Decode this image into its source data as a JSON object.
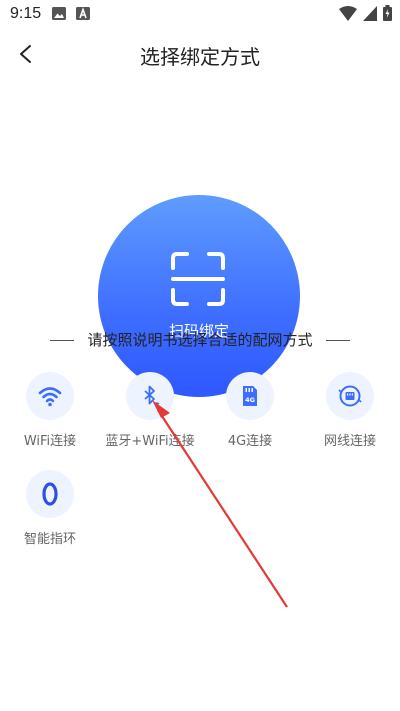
{
  "status_bar": {
    "time": "9:15"
  },
  "header": {
    "title": "选择绑定方式"
  },
  "scan": {
    "label": "扫码绑定"
  },
  "instruction": "请按照说明书选择合适的配网方式",
  "options": [
    {
      "label": "WiFi连接",
      "icon": "wifi-icon"
    },
    {
      "label": "蓝牙+WiFi连接",
      "icon": "bluetooth-icon"
    },
    {
      "label": "4G连接",
      "icon": "sim-4g-icon"
    },
    {
      "label": "网线连接",
      "icon": "ethernet-icon"
    },
    {
      "label": "智能指环",
      "icon": "ring-icon"
    }
  ],
  "colors": {
    "accent": "#3d6dff",
    "icon_bg": "#eef4ff",
    "annotation_arrow": "#e53935"
  }
}
